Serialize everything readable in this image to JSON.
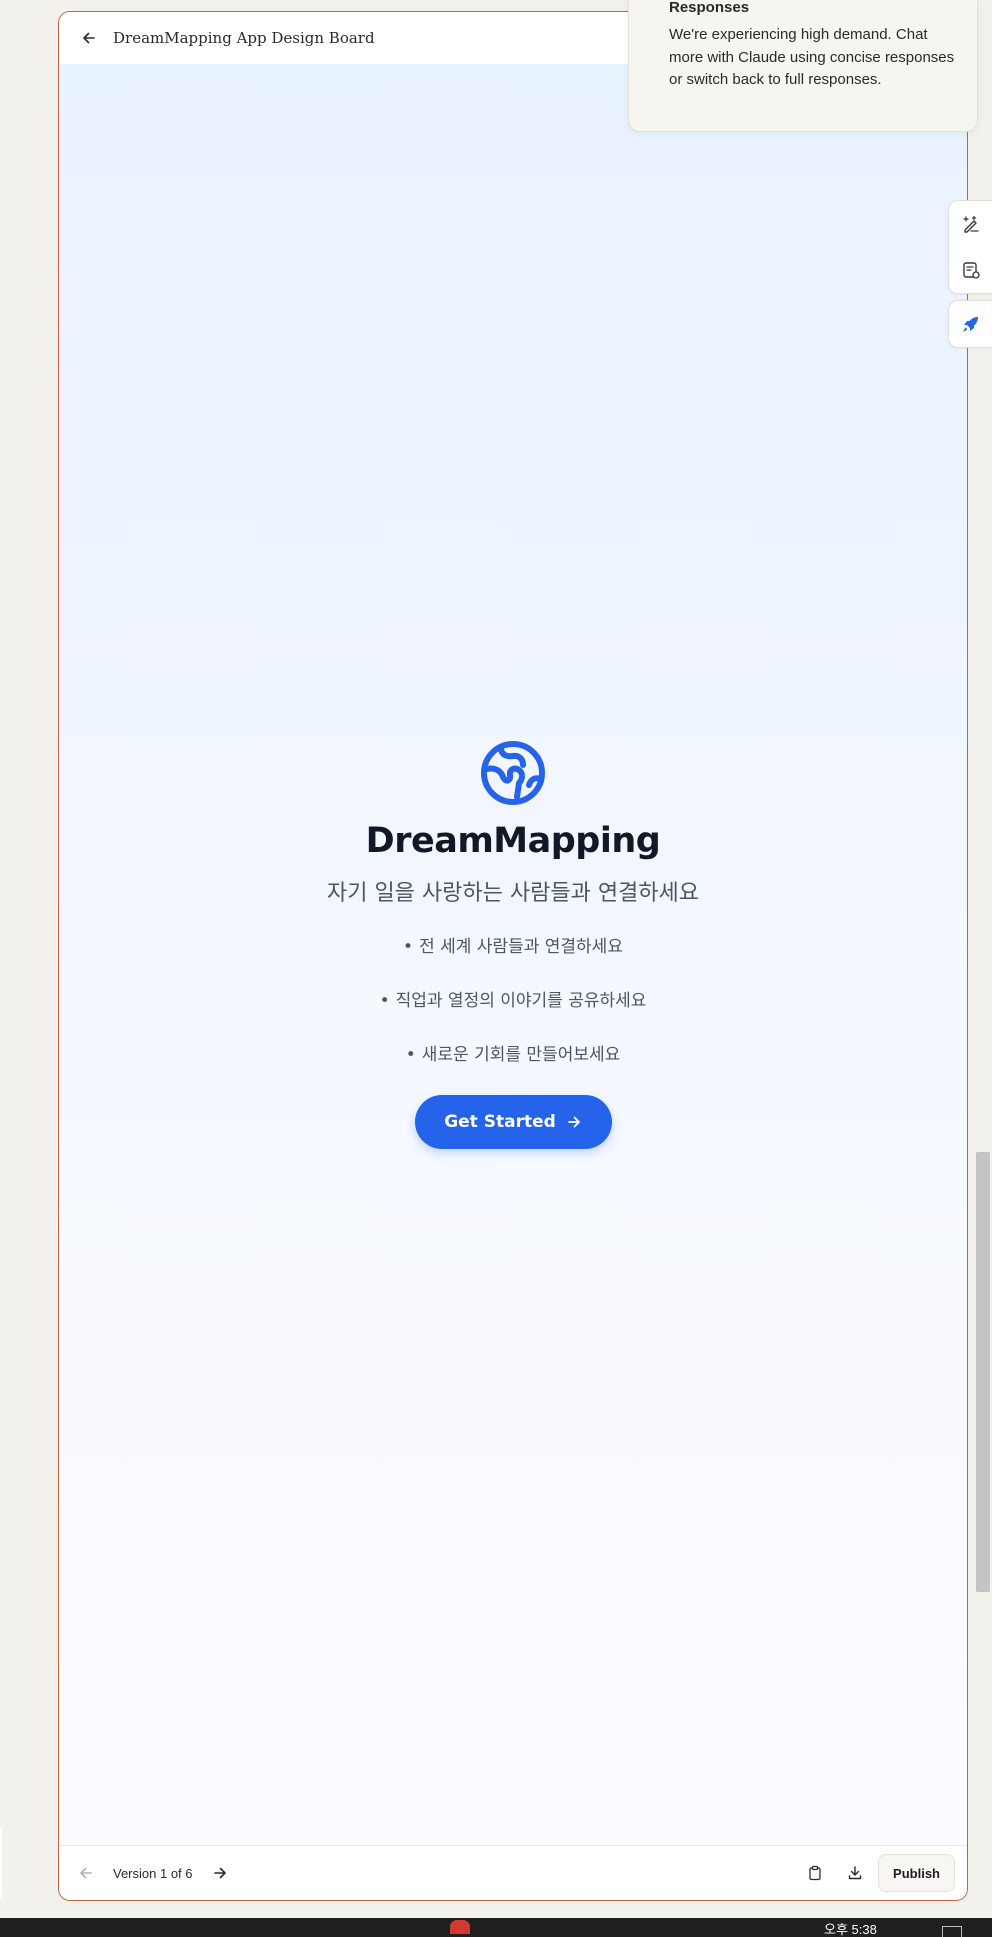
{
  "panel": {
    "title": "DreamMapping App Design Board"
  },
  "app": {
    "name": "DreamMapping",
    "tagline": "자기 일을 사랑하는 사람들과 연결하세요",
    "features": [
      "전 세계 사람들과 연결하세요",
      "직업과 열정의 이야기를 공유하세요",
      "새로운 기회를 만들어보세요"
    ],
    "bullet": "•",
    "cta_label": "Get Started",
    "accent_color": "#2563eb"
  },
  "footer": {
    "version_label": "Version 1 of 6",
    "publish_label": "Publish"
  },
  "toast": {
    "title": "Responses",
    "body": "We're experiencing high demand. Chat more with Claude using concise responses or switch back to full responses."
  },
  "taskbar": {
    "clock": "오후 5:38"
  },
  "icons": {
    "back": "arrow-left-icon",
    "globe": "globe-icon",
    "cta_arrow": "arrow-right-icon",
    "prev": "arrow-left-icon",
    "next": "arrow-right-icon",
    "copy": "clipboard-icon",
    "download": "download-icon",
    "tool_1": "edit-sparkle-icon",
    "tool_2": "document-edit-icon",
    "tool_3": "rocket-icon"
  }
}
